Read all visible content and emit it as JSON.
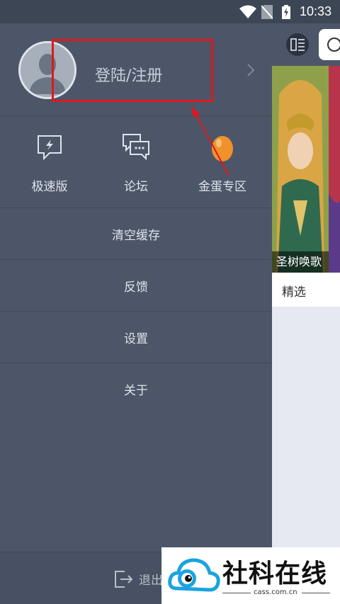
{
  "status_bar": {
    "time": "10:33",
    "icons": [
      "wifi-icon",
      "no-sim-icon",
      "battery-charging-icon"
    ]
  },
  "drawer": {
    "profile": {
      "login_label": "登陆/注册"
    },
    "quick_actions": [
      {
        "label": "极速版",
        "icon": "lightning-chat-icon"
      },
      {
        "label": "论坛",
        "icon": "chat-bubbles-icon"
      },
      {
        "label": "金蛋专区",
        "icon": "golden-egg-icon"
      }
    ],
    "menu": [
      {
        "label": "清空缓存"
      },
      {
        "label": "反馈"
      },
      {
        "label": "设置"
      },
      {
        "label": "关于"
      }
    ],
    "logout_label": "退出"
  },
  "right_panel": {
    "banner_caption": "圣树唤歌",
    "tab_label": "精选"
  },
  "watermark": {
    "brand": "社科在线",
    "url": "cass.com.cn"
  },
  "colors": {
    "drawer_bg": "#4c5668",
    "highlight_red": "#e0161e",
    "egg_orange": "#f0922b"
  }
}
